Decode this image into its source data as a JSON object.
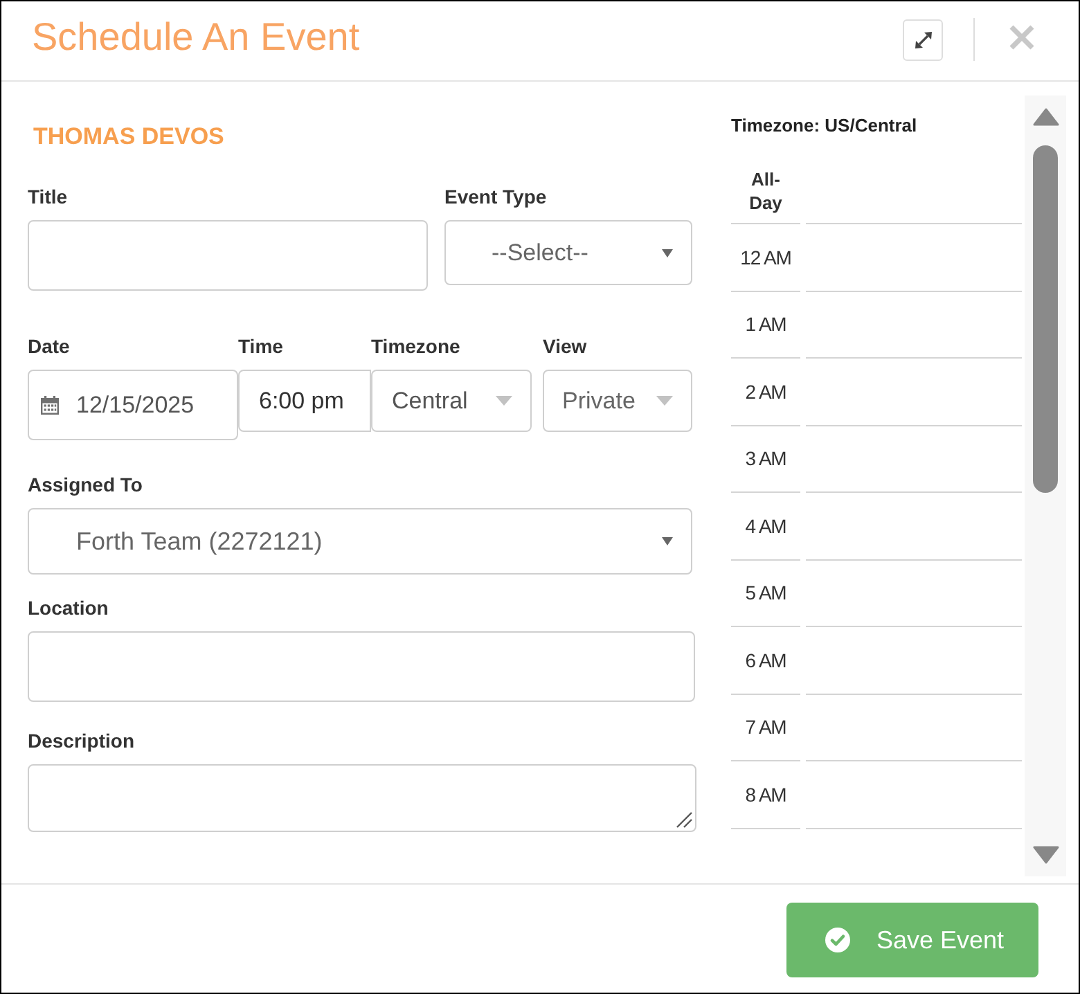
{
  "dialog": {
    "title": "Schedule An Event"
  },
  "owner_name": "THOMAS DEVOS",
  "form_rows": [
    [
      {
        "kind": "text",
        "label": "Title"
      },
      {
        "kind": "select",
        "label": "Event Type",
        "value": "--Select--"
      }
    ],
    [
      {
        "kind": "date",
        "label": "Date",
        "value": "12/15/2025"
      },
      {
        "kind": "time",
        "label": "Time",
        "value": "6:00 pm"
      },
      {
        "kind": "select",
        "label": "Timezone",
        "value": "Central"
      },
      {
        "kind": "select",
        "label": "View",
        "value": "Private"
      }
    ],
    [
      {
        "kind": "select",
        "label": "Assigned To",
        "value": "Forth Team (2272121)"
      }
    ],
    [
      {
        "kind": "text",
        "label": "Location"
      }
    ],
    [
      {
        "kind": "textarea",
        "label": "Description"
      }
    ]
  ],
  "calendar": {
    "timezone": "Timezone: US/Central",
    "all_day_label": "All-Day",
    "hours": [
      "12 AM",
      "1 AM",
      "2 AM",
      "3 AM",
      "4 AM",
      "5 AM",
      "6 AM",
      "7 AM",
      "8 AM"
    ]
  },
  "footer": {
    "save_button": {
      "label": "Save Event"
    }
  }
}
